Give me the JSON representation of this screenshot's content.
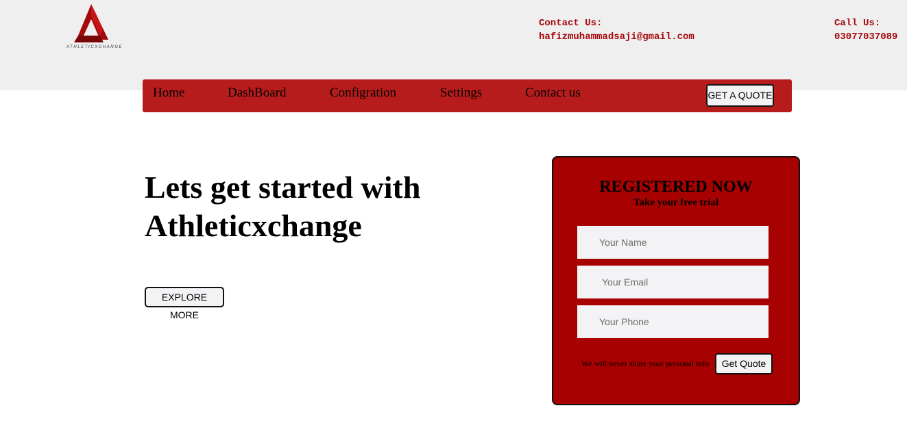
{
  "header": {
    "logo_text": "ATHLETICXCHANGE",
    "contact_label": "Contact Us:",
    "contact_email": "hafizmuhammadsaji@gmail.com",
    "call_label": "Call Us:",
    "call_number": "03077037089"
  },
  "nav": {
    "items": [
      "Home",
      "DashBoard",
      "Configration",
      "Settings",
      "Contact us"
    ],
    "quote_button": "GET A QUOTE"
  },
  "hero": {
    "title": "Lets get started with Athleticxchange",
    "explore_button": "EXPLORE MORE"
  },
  "register": {
    "title": "REGISTERED NOW",
    "subtitle": "Take your free trial",
    "name_placeholder": "Your Name",
    "email_placeholder": "Your Email",
    "phone_placeholder": "Your Phone",
    "privacy_note": "We will never share your personal info",
    "submit_button": "Get Quote"
  },
  "colors": {
    "brand_red": "#b71c1c",
    "card_red": "#a70101",
    "contact_red": "#a3080c",
    "header_bg": "#f0eff0"
  },
  "icons": {
    "logo": "athleticxchange-triangle-logo"
  }
}
